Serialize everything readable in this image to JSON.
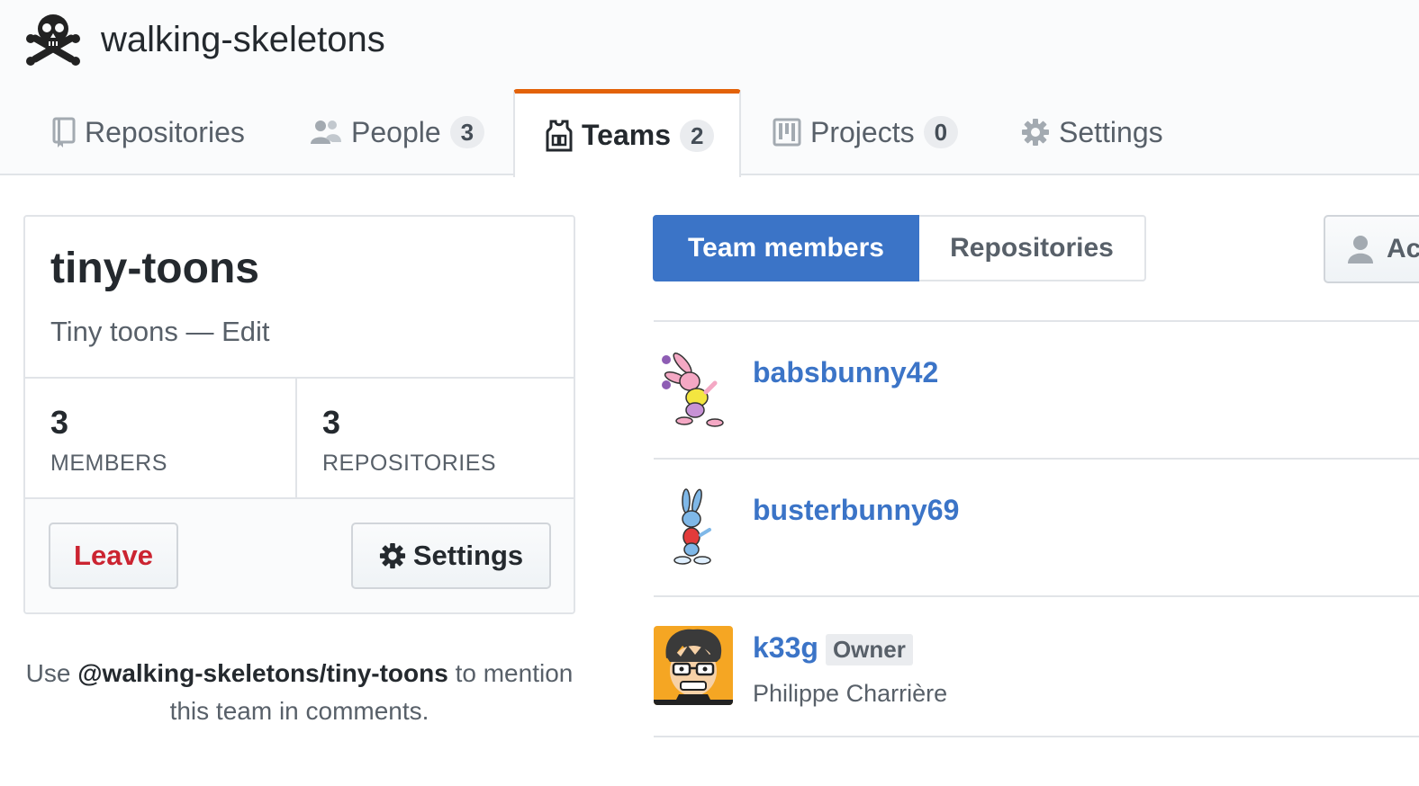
{
  "org": {
    "name": "walking-skeletons",
    "logo_icon": "skull-crossbones-icon"
  },
  "tabs": [
    {
      "label": "Repositories",
      "icon": "repo-icon",
      "counter": null,
      "selected": false
    },
    {
      "label": "People",
      "icon": "people-icon",
      "counter": "3",
      "selected": false
    },
    {
      "label": "Teams",
      "icon": "jersey-icon",
      "counter": "2",
      "selected": true
    },
    {
      "label": "Projects",
      "icon": "project-icon",
      "counter": "0",
      "selected": false
    },
    {
      "label": "Settings",
      "icon": "gear-icon",
      "counter": null,
      "selected": false
    }
  ],
  "team": {
    "name": "tiny-toons",
    "description": "Tiny toons",
    "edit_sep": " — ",
    "edit_label": "Edit",
    "members_count": "3",
    "members_label": "MEMBERS",
    "repos_count": "3",
    "repos_label": "REPOSITORIES",
    "leave_label": "Leave",
    "settings_label": "Settings"
  },
  "mention": {
    "prefix": "Use ",
    "handle": "@walking-skeletons/tiny-toons",
    "suffix": " to mention this team in comments."
  },
  "subnav": {
    "members_label": "Team members",
    "repos_label": "Repositories"
  },
  "add_button": {
    "label": "Ac",
    "icon": "person-icon"
  },
  "members": [
    {
      "login": "babsbunny42",
      "fullname": "",
      "owner": false,
      "avatar": "pink-bunny-avatar"
    },
    {
      "login": "busterbunny69",
      "fullname": "",
      "owner": false,
      "avatar": "blue-bunny-avatar"
    },
    {
      "login": "k33g",
      "fullname": "Philippe Charrière",
      "owner": true,
      "owner_label": "Owner",
      "avatar": "cartoon-man-avatar"
    }
  ],
  "colors": {
    "accent_blue": "#3b74c7",
    "tab_underline": "#e36209",
    "leave_red": "#cb2431"
  }
}
